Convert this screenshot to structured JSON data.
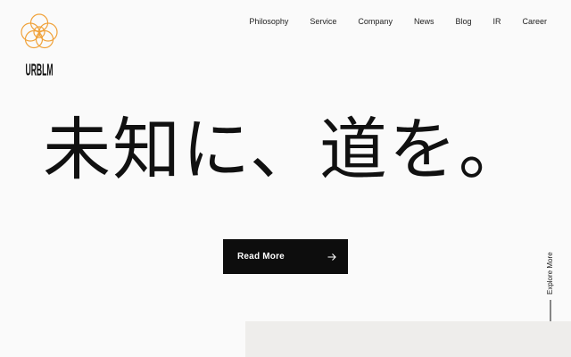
{
  "brand": {
    "wordmark": "URBLM",
    "accent_color": "#f0a23a",
    "logo_icon": "interlocking-circles-logo"
  },
  "nav": {
    "items": [
      {
        "label": "Philosophy"
      },
      {
        "label": "Service"
      },
      {
        "label": "Company"
      },
      {
        "label": "News"
      },
      {
        "label": "Blog"
      },
      {
        "label": "IR"
      },
      {
        "label": "Career"
      }
    ]
  },
  "hero": {
    "headline": "未知に、道を。",
    "cta_label": "Read More",
    "cta_icon": "arrow-right-icon",
    "cta_background": "#0d0d0d"
  },
  "scroll_hint": {
    "label": "Explore More",
    "icon": "arrow-down-icon"
  }
}
